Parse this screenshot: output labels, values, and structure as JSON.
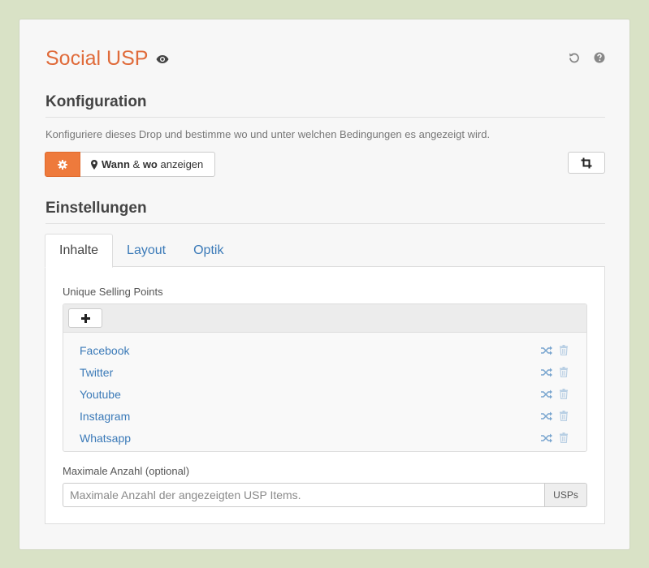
{
  "header": {
    "title": "Social USP",
    "preview_icon": "eye-icon",
    "reset_icon": "undo-icon",
    "help_icon": "question-circle-icon"
  },
  "konfiguration": {
    "heading": "Konfiguration",
    "description": "Konfiguriere dieses Drop und bestimme wo und unter welchen Bedingungen es angezeigt wird.",
    "settings_icon": "gear-icon",
    "where_when": {
      "icon": "map-marker-icon",
      "part1": "Wann",
      "part2": " & ",
      "part3": "wo",
      "part4": " anzeigen"
    },
    "crop_icon": "crop-icon"
  },
  "einstellungen": {
    "heading": "Einstellungen",
    "tabs": [
      {
        "label": "Inhalte",
        "active": true
      },
      {
        "label": "Layout",
        "active": false
      },
      {
        "label": "Optik",
        "active": false
      }
    ]
  },
  "usp": {
    "label": "Unique Selling Points",
    "add_icon": "plus-icon",
    "items": [
      {
        "name": "Facebook"
      },
      {
        "name": "Twitter"
      },
      {
        "name": "Youtube"
      },
      {
        "name": "Instagram"
      },
      {
        "name": "Whatsapp"
      }
    ]
  },
  "max_count": {
    "label": "Maximale Anzahl (optional)",
    "placeholder": "Maximale Anzahl der angezeigten USP Items.",
    "value": "",
    "addon": "USPs"
  },
  "colors": {
    "accent": "#ee7a3c",
    "title": "#e06b3a",
    "link": "#3b7ab8",
    "background": "#d9e2c6"
  }
}
